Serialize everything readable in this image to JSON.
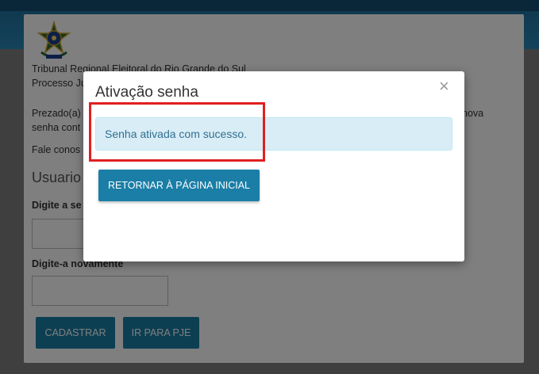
{
  "background_page": {
    "org_name": "Tribunal Regional Eleitoral do Rio Grande do Sul",
    "system_name": "Processo Ju",
    "greeting_start": "Prezado(a)",
    "greeting_end": "nova",
    "greeting_line2": "senha cont",
    "contact": "Fale conos",
    "section_heading": "Usuario",
    "password_label": "Digite a se",
    "confirm_label": "Digite-a novamente",
    "register_button": "CADASTRAR",
    "pje_button": "IR PARA PJE"
  },
  "modal": {
    "title": "Ativação senha",
    "close_symbol": "×",
    "success_message": "Senha ativada com sucesso.",
    "return_button": "RETORNAR À PÁGINA INICIAL"
  },
  "colors": {
    "accent": "#1a7ea6",
    "alert_bg": "#d9edf7",
    "alert_text": "#31708f",
    "highlight": "#e02020"
  }
}
